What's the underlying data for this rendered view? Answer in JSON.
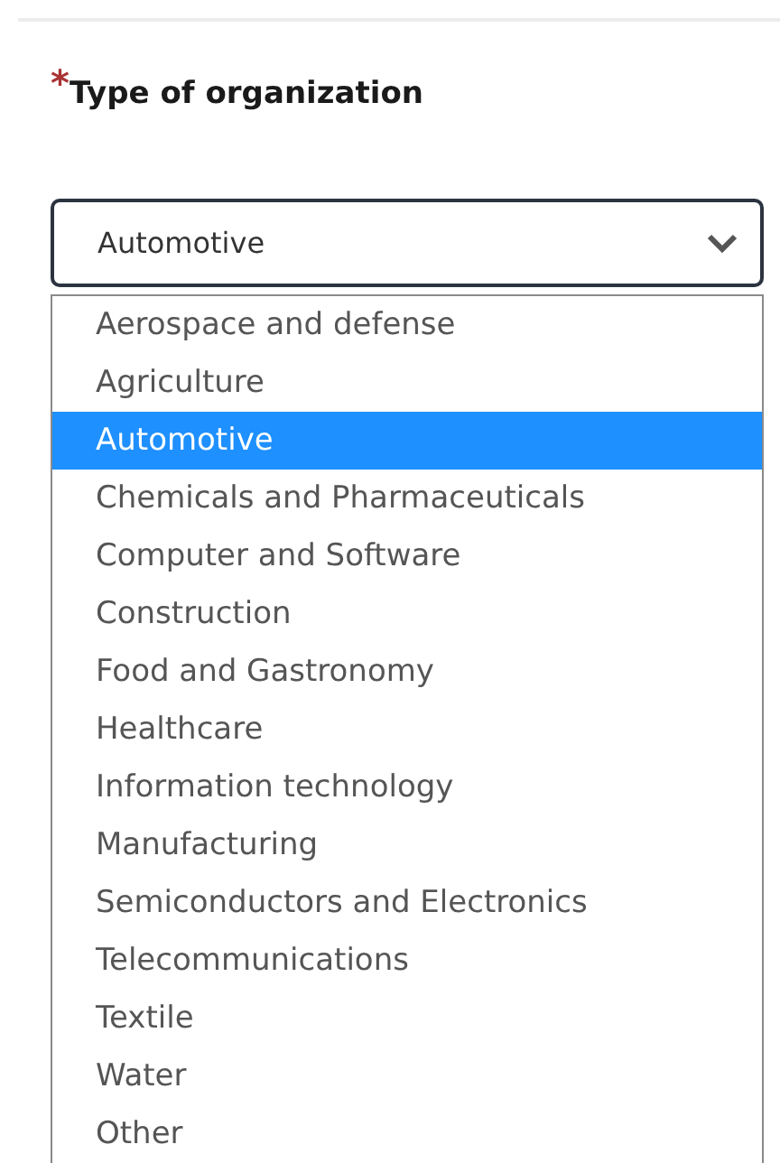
{
  "field": {
    "required_mark": "*",
    "label": "Type of organization",
    "value": "Automotive"
  },
  "options": [
    {
      "label": "Aerospace and defense",
      "selected": false
    },
    {
      "label": "Agriculture",
      "selected": false
    },
    {
      "label": "Automotive",
      "selected": true
    },
    {
      "label": "Chemicals and Pharmaceuticals",
      "selected": false
    },
    {
      "label": "Computer and Software",
      "selected": false
    },
    {
      "label": "Construction",
      "selected": false
    },
    {
      "label": "Food and Gastronomy",
      "selected": false
    },
    {
      "label": "Healthcare",
      "selected": false
    },
    {
      "label": "Information technology",
      "selected": false
    },
    {
      "label": "Manufacturing",
      "selected": false
    },
    {
      "label": "Semiconductors and Electronics",
      "selected": false
    },
    {
      "label": "Telecommunications",
      "selected": false
    },
    {
      "label": "Textile",
      "selected": false
    },
    {
      "label": "Water",
      "selected": false
    },
    {
      "label": "Other",
      "selected": false
    }
  ]
}
